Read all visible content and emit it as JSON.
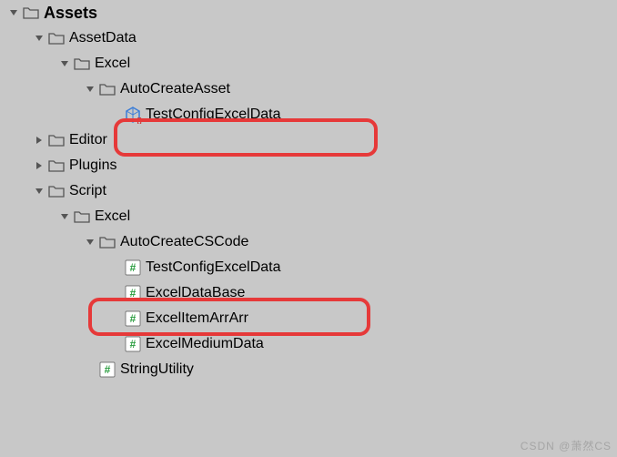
{
  "tree": {
    "assets": "Assets",
    "assetData": "AssetData",
    "excel1": "Excel",
    "autoCreateAsset": "AutoCreateAsset",
    "testConfigExcelData1": "TestConfigExcelData",
    "editor": "Editor",
    "plugins": "Plugins",
    "script": "Script",
    "excel2": "Excel",
    "autoCreateCSCode": "AutoCreateCSCode",
    "testConfigExcelData2": "TestConfigExcelData",
    "excelDataBase": "ExcelDataBase",
    "excelItemArrArr": "ExcelItemArrArr",
    "excelMediumData": "ExcelMediumData",
    "stringUtility": "StringUtility"
  },
  "watermark": "CSDN @萧然CS"
}
